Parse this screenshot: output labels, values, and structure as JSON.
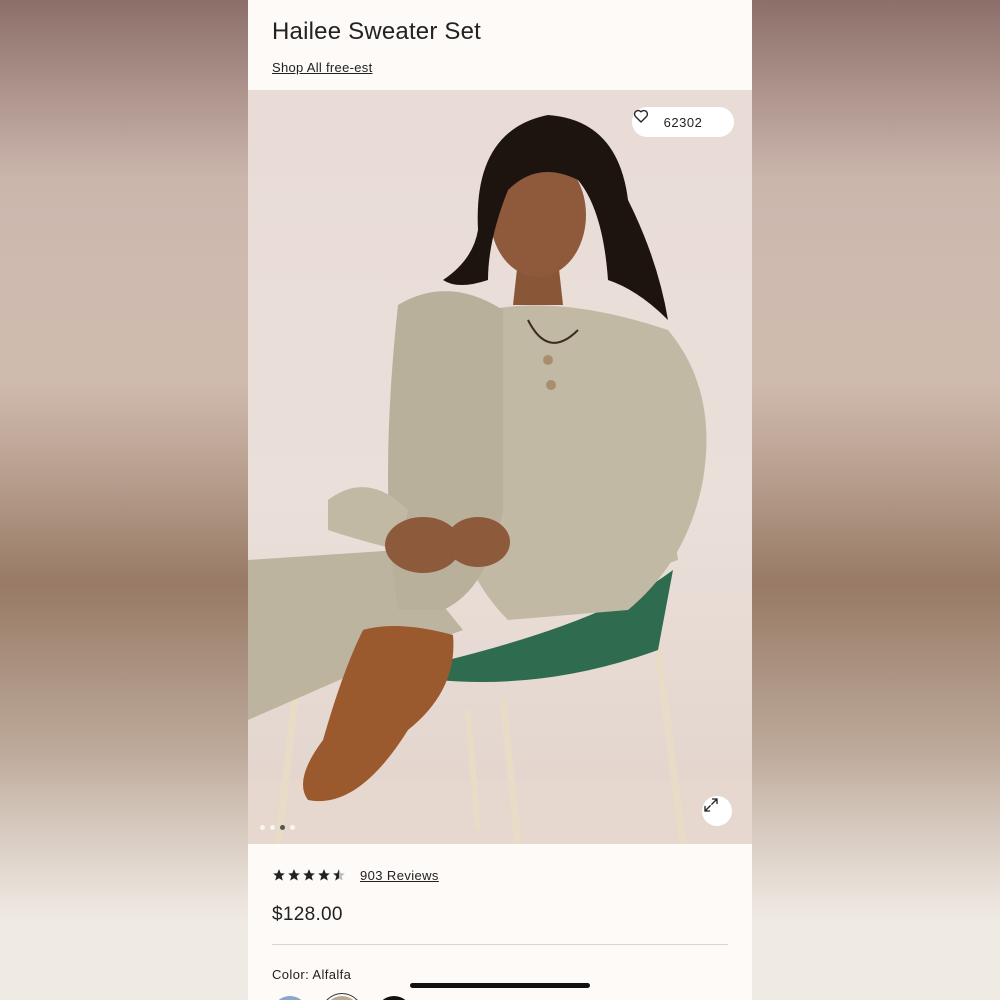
{
  "product": {
    "title": "Hailee Sweater Set",
    "shop_link": "Shop All free-est",
    "favorites_count": "62302",
    "rating": 4.5,
    "reviews_label": "903 Reviews",
    "price": "$128.00",
    "color_label": "Color: Alfalfa"
  },
  "gallery": {
    "image_count": 4,
    "active_index": 2
  },
  "swatches": [
    {
      "color": "#8aa6cb"
    },
    {
      "color": "#b8ac95"
    },
    {
      "color": "#111111"
    }
  ],
  "icons": {
    "favorite": "heart-outline-icon",
    "expand": "expand-arrows-icon",
    "star": "star-icon"
  }
}
